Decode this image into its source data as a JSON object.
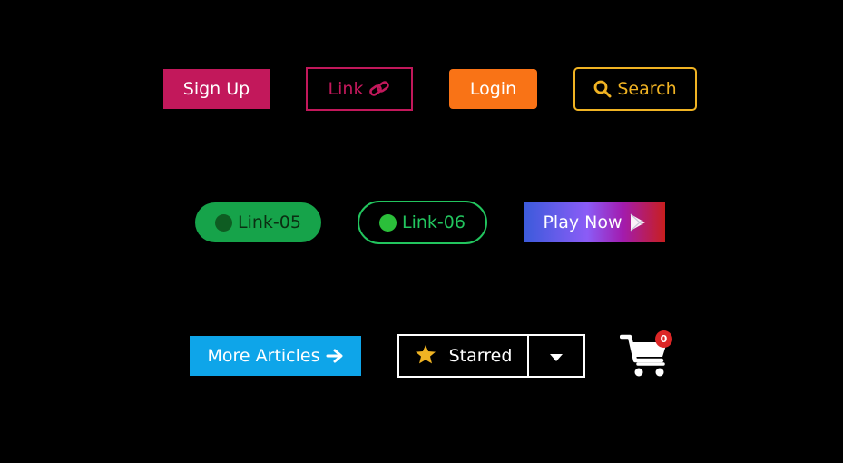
{
  "row1": {
    "signup_label": "Sign Up",
    "link_label": "Link",
    "link_icon": "link-icon",
    "login_label": "Login",
    "search_label": "Search",
    "search_icon": "search-icon"
  },
  "row2": {
    "link05_label": "Link-05",
    "link06_label": "Link-06",
    "play_label": "Play Now",
    "play_icon": "play-store-icon"
  },
  "row3": {
    "more_label": "More Articles",
    "more_icon": "arrow-right-icon",
    "starred_label": "Starred",
    "starred_icon": "star-icon",
    "dropdown_icon": "caret-down-icon",
    "cart_icon": "shopping-cart-icon",
    "cart_count": "0"
  },
  "colors": {
    "background": "#000000",
    "pink": "#c2185b",
    "orange": "#f97316",
    "gold": "#f0b323",
    "green": "#16a34a",
    "green_outline": "#22c55e",
    "sky": "#0ea5e9",
    "badge_red": "#dc2626"
  }
}
